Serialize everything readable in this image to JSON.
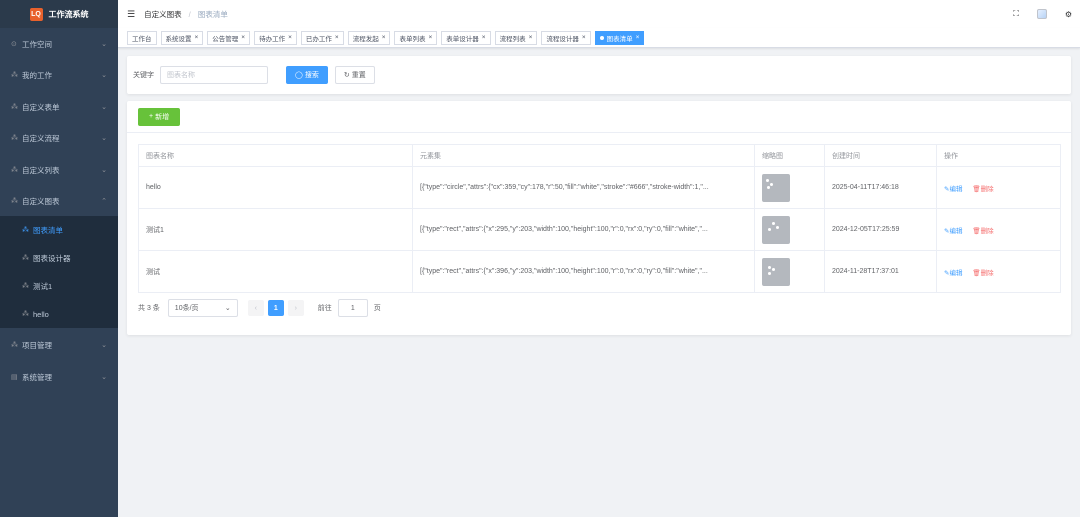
{
  "app": {
    "logo_mark": "LQ",
    "title": "工作流系统"
  },
  "sidebar": {
    "items": [
      {
        "icon": "⊙",
        "label": "工作空间",
        "chevron": "⌄"
      },
      {
        "icon": "⁂",
        "label": "我的工作",
        "chevron": "⌄"
      },
      {
        "icon": "⁂",
        "label": "自定义表单",
        "chevron": "⌄"
      },
      {
        "icon": "⁂",
        "label": "自定义流程",
        "chevron": "⌄"
      },
      {
        "icon": "⁂",
        "label": "自定义列表",
        "chevron": "⌄"
      },
      {
        "icon": "⁂",
        "label": "自定义图表",
        "chevron": "⌃"
      },
      {
        "icon": "⁂",
        "label": "图表清单"
      },
      {
        "icon": "⁂",
        "label": "图表设计器"
      },
      {
        "icon": "⁂",
        "label": "测试1"
      },
      {
        "icon": "⁂",
        "label": "hello"
      },
      {
        "icon": "⁂",
        "label": "项目管理",
        "chevron": "⌄"
      },
      {
        "icon": "▤",
        "label": "系统管理",
        "chevron": "⌄"
      }
    ]
  },
  "header": {
    "hamburger": "☰",
    "breadcrumb": [
      "自定义图表",
      "/",
      "图表清单"
    ],
    "fullscreen": "⛶",
    "settings": "⚙"
  },
  "tags": [
    {
      "label": "工作台"
    },
    {
      "label": "系统设置",
      "close": "×"
    },
    {
      "label": "公告管理",
      "close": "×"
    },
    {
      "label": "待办工作",
      "close": "×"
    },
    {
      "label": "已办工作",
      "close": "×"
    },
    {
      "label": "流程发起",
      "close": "×"
    },
    {
      "label": "表单列表",
      "close": "×"
    },
    {
      "label": "表单设计器",
      "close": "×"
    },
    {
      "label": "流程列表",
      "close": "×"
    },
    {
      "label": "流程设计器",
      "close": "×"
    },
    {
      "label": "图表清单",
      "close": "×"
    }
  ],
  "search": {
    "label": "关键字",
    "placeholder": "图表名称",
    "search_button": "搜索",
    "search_icon": "◯",
    "reset_button": "重置",
    "reset_icon": "↻"
  },
  "toolbar": {
    "add_label": "新增",
    "add_icon": "+"
  },
  "table": {
    "headers": [
      "图表名称",
      "元素集",
      "缩略图",
      "创建时间",
      "操作"
    ],
    "rows": [
      {
        "name": "hello",
        "elements": "[{\"type\":\"circle\",\"attrs\":{\"cx\":359,\"cy\":178,\"r\":50,\"fill\":\"white\",\"stroke\":\"#666\",\"stroke-width\":1,\"...",
        "created": "2025-04-11T17:46:18"
      },
      {
        "name": "测试1",
        "elements": "[{\"type\":\"rect\",\"attrs\":{\"x\":295,\"y\":203,\"width\":100,\"height\":100,\"r\":0,\"rx\":0,\"ry\":0,\"fill\":\"white\",\"...",
        "created": "2024-12-05T17:25:59"
      },
      {
        "name": "测试",
        "elements": "[{\"type\":\"rect\",\"attrs\":{\"x\":396,\"y\":203,\"width\":100,\"height\":100,\"r\":0,\"rx\":0,\"ry\":0,\"fill\":\"white\",\"...",
        "created": "2024-11-28T17:37:01"
      }
    ],
    "edit_label": "编辑",
    "edit_icon": "✎",
    "delete_label": "删除",
    "delete_icon": "🗑"
  },
  "pager": {
    "total": "共 3 条",
    "page_size": "10条/页",
    "select_arrow": "⌄",
    "prev": "‹",
    "current": "1",
    "next": "›",
    "goto_label": "前往",
    "goto_value": "1",
    "goto_suffix": "页"
  },
  "colors": {
    "primary": "#409eff",
    "success": "#67c23a",
    "danger": "#f56c6c",
    "sidebar": "#304156"
  }
}
